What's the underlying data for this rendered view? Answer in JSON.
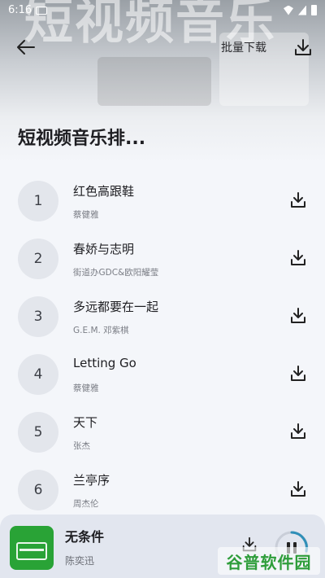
{
  "status_bar": {
    "time": "6:16"
  },
  "hero": {
    "art_text": "短视频音乐"
  },
  "toolbar": {
    "batch_download_label": "批量下载"
  },
  "page": {
    "title": "短视频音乐排..."
  },
  "songs": [
    {
      "rank": "1",
      "title": "红色高跟鞋",
      "artist": "蔡健雅"
    },
    {
      "rank": "2",
      "title": "春娇与志明",
      "artist": "街道办GDC&欧阳耀莹"
    },
    {
      "rank": "3",
      "title": "多远都要在一起",
      "artist": "G.E.M. 邓紫棋"
    },
    {
      "rank": "4",
      "title": "Letting Go",
      "artist": "蔡健雅"
    },
    {
      "rank": "5",
      "title": "天下",
      "artist": "张杰"
    },
    {
      "rank": "6",
      "title": "兰亭序",
      "artist": "周杰伦"
    }
  ],
  "now_playing": {
    "title": "无条件",
    "artist": "陈奕迅"
  },
  "watermark": {
    "text": "谷普软件园"
  },
  "colors": {
    "accent": "#2f8fb8",
    "cover": "#29a336",
    "player_bg": "#e2e6ef"
  }
}
